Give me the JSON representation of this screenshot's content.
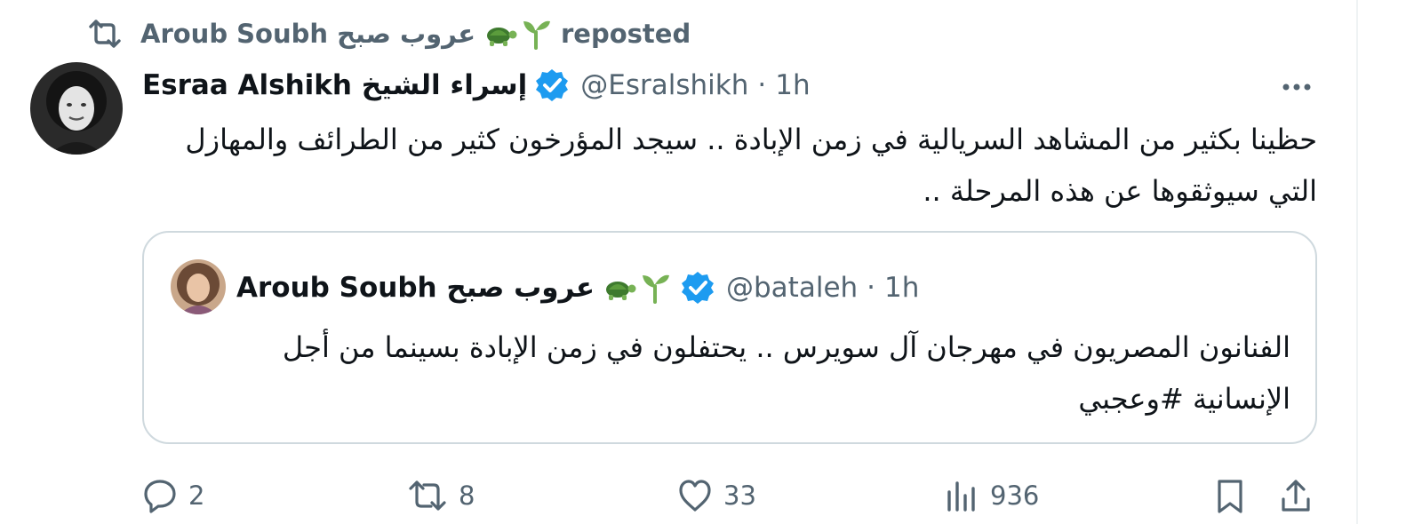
{
  "repost": {
    "display_name": "Aroub Soubh عروب صبح",
    "label": "reposted"
  },
  "tweet": {
    "author_name": "Esraa Alshikh إسراء الشيخ",
    "handle": "@Esralshikh",
    "separator": "·",
    "time": "1h",
    "text": "حظينا بكثير من المشاهد السريالية في زمن الإبادة .. سيجد المؤرخون كثير من الطرائف والمهازل التي سيوثقوها عن هذه المرحلة .."
  },
  "quote": {
    "author_name": "Aroub Soubh عروب صبح",
    "handle": "@bataleh",
    "separator": "·",
    "time": "1h",
    "text": "الفنانون المصريون في مهرجان آل سويرس .. يحتفلون في زمن الإبادة بسينما من أجل الإنسانية #وعجبي"
  },
  "actions": {
    "replies": "2",
    "reposts": "8",
    "likes": "33",
    "views": "936"
  },
  "icons": {
    "repost_header": "repost-icon",
    "emoji_seedling": "seedling-emoji",
    "emoji_turtle": "turtle-emoji",
    "verified": "verified-badge-icon",
    "more": "more-dots-icon",
    "reply": "reply-icon",
    "repost": "repost-icon",
    "like": "heart-icon",
    "views": "views-chart-icon",
    "bookmark": "bookmark-icon",
    "share": "share-icon"
  },
  "colors": {
    "text_primary": "#0f1419",
    "text_secondary": "#536471",
    "verified_blue": "#1d9bf0",
    "border": "#cfd9de"
  }
}
